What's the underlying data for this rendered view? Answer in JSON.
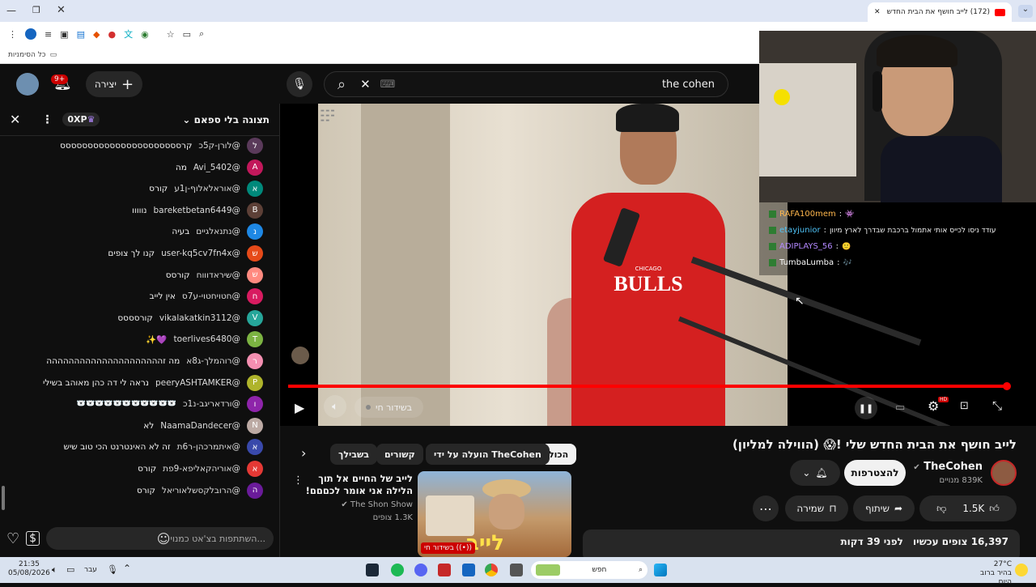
{
  "browser": {
    "tab_title": "(172) לייב חושף את הבית החדש",
    "bookmarks_label": "כל הסימניות"
  },
  "header": {
    "search_value": "the cohen",
    "create_label": "יצירה",
    "notif_badge": "9+"
  },
  "chat": {
    "mode_label": "תצוגה בלי ספאם",
    "xp_badge": "0XP",
    "messages": [
      {
        "author": "@לורן-ק5כ",
        "text": "קרסססססססססססססססססססססס",
        "av": "ל",
        "color": "#5a3a5a"
      },
      {
        "author": "@Avi_5402",
        "text": "מה",
        "av": "A",
        "color": "#c2185b"
      },
      {
        "author": "@אוראלאלוף-ן1ע",
        "text": "קורס",
        "av": "א",
        "color": "#00897b"
      },
      {
        "author": "@bareketbetan6449",
        "text": "נווווו",
        "av": "B",
        "color": "#5d4037"
      },
      {
        "author": "@נתנאלגיים",
        "text": "בעיה",
        "av": "נ",
        "color": "#1e88e5"
      },
      {
        "author": "@user-kq5cv7fn4x",
        "text": "קנו לך צופים",
        "av": "ש",
        "color": "#e64a19"
      },
      {
        "author": "@שיראדוווח",
        "text": "קורסס",
        "av": "ש",
        "color": "#ff8a80"
      },
      {
        "author": "@חטויחטוי-ע7ס",
        "text": "אין לייב",
        "av": "ח",
        "color": "#d81b60"
      },
      {
        "author": "@vikalakatkin3112",
        "text": "קורסססס",
        "av": "V",
        "color": "#26a69a"
      },
      {
        "author": "@toerlives6480",
        "text": "💜✨",
        "av": "T",
        "color": "#7cb342"
      },
      {
        "author": "@רוהמלך-ג8א",
        "text": "מה זההההההההההההההההההההה",
        "av": "ר",
        "color": "#f48fb1"
      },
      {
        "author": "@peeryASHTAMKER",
        "text": "נראה לי דה כהן מאוהב בשילי",
        "av": "P",
        "color": "#afb42b"
      },
      {
        "author": "@ורדאריגב-נ1כ",
        "text": "🐻‍❄️🐻‍❄️🐻‍❄️🐻‍❄️🐻‍❄️🐻‍❄️🐻‍❄️🐻‍❄️🐻‍❄️🐻‍❄️🐻‍❄️",
        "av": "ו",
        "color": "#8e24aa"
      },
      {
        "author": "@NaamaDandecer",
        "text": "לא",
        "av": "N",
        "color": "#bcaaa4"
      },
      {
        "author": "@איתמרכהן-ר6ת",
        "text": "זה לא האינטרנט הכי טוב שיש",
        "av": "א",
        "color": "#3949ab"
      },
      {
        "author": "@אוריהקאליפא-9פת",
        "text": "קורס",
        "av": "א",
        "color": "#e53935"
      },
      {
        "author": "@הרובלקסשלאוריאל",
        "text": "קורס",
        "av": "ה",
        "color": "#6a1b9a"
      }
    ],
    "input_placeholder": "השתתפות בצ'אט כמנוי..."
  },
  "player": {
    "live_label": "בשידור חי",
    "shirt_brand": "CHICAGO",
    "shirt_team": "BULLS",
    "overlay_messages": [
      {
        "user": "RAFA100mem",
        "sep": ":",
        "text": "👾",
        "color": "#ffb74d"
      },
      {
        "user": "etayjunior",
        "sep": ":",
        "text": "עודד ניסו לכייס אותי אתמול ברכבת שבדרך לארץ מיוון",
        "color": "#4fc3f7"
      },
      {
        "user": "ADIPLAYS_56",
        "sep": ":",
        "text": "🙂",
        "color": "#b388ff"
      },
      {
        "user": "TumbaLumba",
        "sep": ":",
        "text": "🎶",
        "color": "#ffffff"
      }
    ]
  },
  "video": {
    "title": "לייב חושף את הבית החדש שלי !😱 (הווילה למליון)",
    "channel": "TheCohen",
    "subs": "839K מנויים",
    "subscribe": "להצטרפות",
    "likes": "1.5K",
    "share": "שיתוף",
    "save": "שמירה",
    "viewers": "16,397 צופים עכשיו",
    "started": "לפני 39 דקות",
    "filters": [
      "הכול",
      "הועלה על ידי TheCohen",
      "קשורים",
      "בשבילך"
    ]
  },
  "related": {
    "title": "לייב של החיים אל תוך הלילה אני אומר לכםםם!",
    "channel": "The Shon Show",
    "views": "1.3K צופים",
    "thumb_text": "לייב",
    "badge": "בשידור חי"
  },
  "taskbar": {
    "time": "21:35",
    "date": "05/08/2026",
    "weather": "27°C",
    "weather_desc": "בהיר ברוב היום",
    "search": "חפש",
    "lang": "עבר"
  }
}
